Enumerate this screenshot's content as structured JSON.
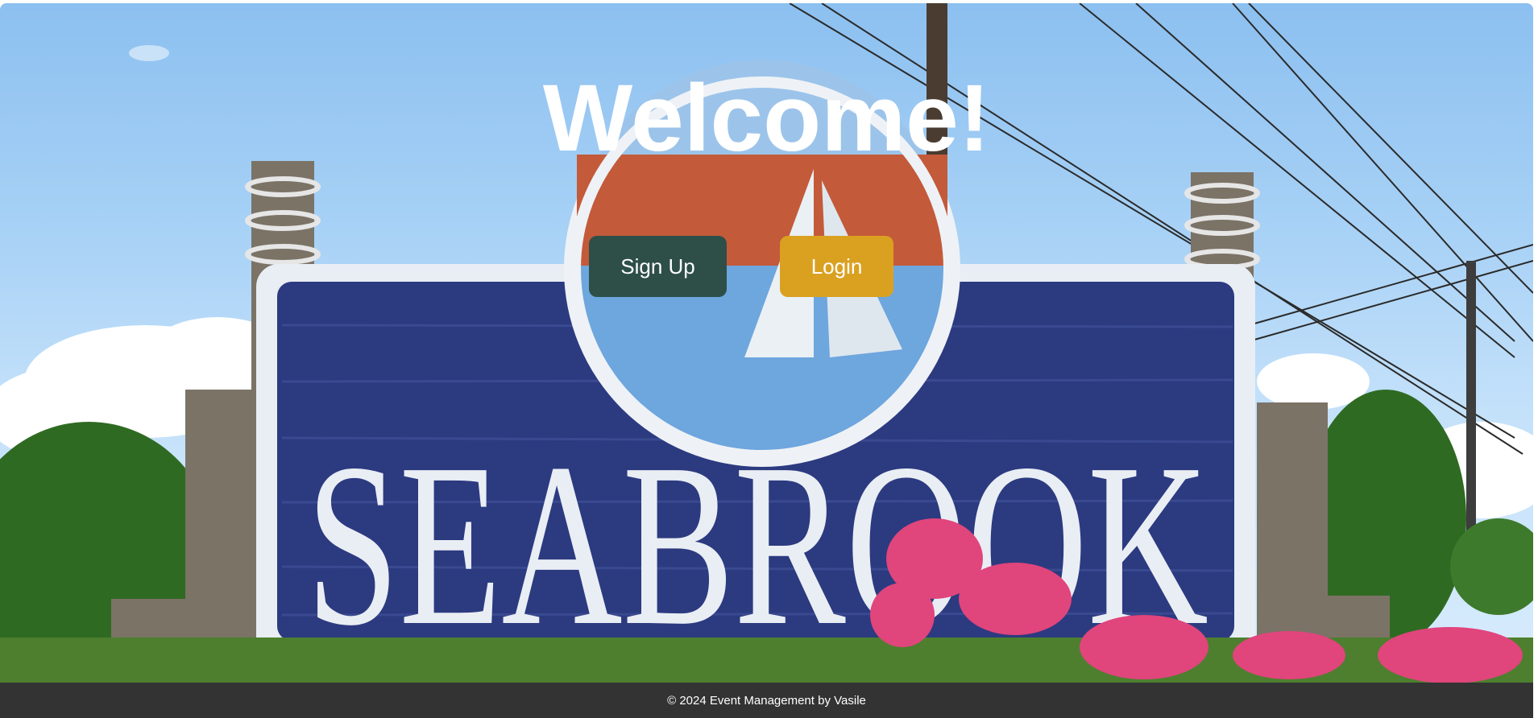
{
  "hero": {
    "heading": "Welcome!",
    "sign_text": "SEABROOK"
  },
  "actions": {
    "signup_label": "Sign Up",
    "login_label": "Login"
  },
  "footer": {
    "text": "© 2024 Event Management by Vasile"
  },
  "colors": {
    "signup_bg": "#2d4f48",
    "login_bg": "#daa121",
    "footer_bg": "#333333",
    "sign_navy": "#2c3a80"
  }
}
